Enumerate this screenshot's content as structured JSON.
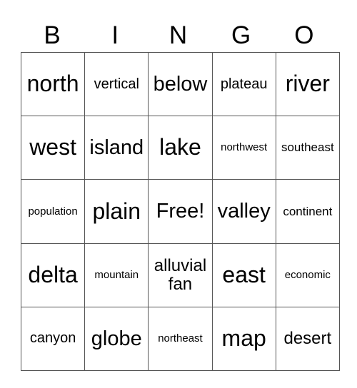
{
  "header": [
    "B",
    "I",
    "N",
    "G",
    "O"
  ],
  "rows": [
    [
      {
        "text": "north",
        "size": "xl"
      },
      {
        "text": "vertical",
        "size": "s"
      },
      {
        "text": "below",
        "size": "l"
      },
      {
        "text": "plateau",
        "size": "s"
      },
      {
        "text": "river",
        "size": "xl"
      }
    ],
    [
      {
        "text": "west",
        "size": "xl"
      },
      {
        "text": "island",
        "size": "l"
      },
      {
        "text": "lake",
        "size": "xl"
      },
      {
        "text": "northwest",
        "size": "xxs"
      },
      {
        "text": "southeast",
        "size": "xs"
      }
    ],
    [
      {
        "text": "population",
        "size": "xxs"
      },
      {
        "text": "plain",
        "size": "xl"
      },
      {
        "text": "Free!",
        "size": "l"
      },
      {
        "text": "valley",
        "size": "l"
      },
      {
        "text": "continent",
        "size": "xs"
      }
    ],
    [
      {
        "text": "delta",
        "size": "xl"
      },
      {
        "text": "mountain",
        "size": "xxs"
      },
      {
        "text": "alluvial fan",
        "size": "m"
      },
      {
        "text": "east",
        "size": "xl"
      },
      {
        "text": "economic",
        "size": "xxs"
      }
    ],
    [
      {
        "text": "canyon",
        "size": "s"
      },
      {
        "text": "globe",
        "size": "l"
      },
      {
        "text": "northeast",
        "size": "xxs"
      },
      {
        "text": "map",
        "size": "xl"
      },
      {
        "text": "desert",
        "size": "m"
      }
    ]
  ]
}
